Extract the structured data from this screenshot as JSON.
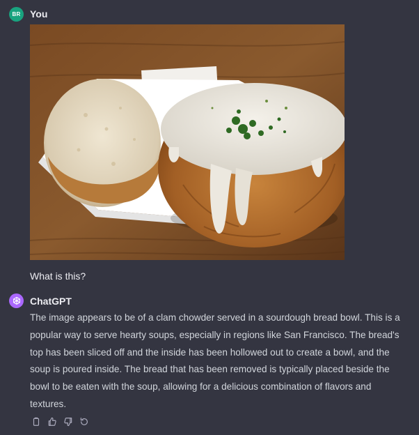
{
  "user_message": {
    "avatar_initials": "BR",
    "author": "You",
    "image_alt": "Clam chowder served in a sourdough bread bowl on a paper tray",
    "prompt": "What is this?"
  },
  "assistant_message": {
    "avatar_icon": "openai-logo-icon",
    "author": "ChatGPT",
    "response": "The image appears to be of a clam chowder served in a sourdough bread bowl. This is a popular way to serve hearty soups, especially in regions like San Francisco. The bread's top has been sliced off and the inside has been hollowed out to create a bowl, and the soup is poured inside. The bread that has been removed is typically placed beside the bowl to be eaten with the soup, allowing for a delicious combination of flavors and textures.",
    "actions": [
      {
        "name": "copy-icon",
        "label": "Copy"
      },
      {
        "name": "thumbs-up-icon",
        "label": "Good response"
      },
      {
        "name": "thumbs-down-icon",
        "label": "Bad response"
      },
      {
        "name": "regenerate-icon",
        "label": "Regenerate"
      }
    ]
  },
  "colors": {
    "background": "#343541",
    "user_avatar": "#19a37f",
    "assistant_avatar": "#ab68ff",
    "text_primary": "#ececf1",
    "text_secondary": "#d1d5db"
  }
}
